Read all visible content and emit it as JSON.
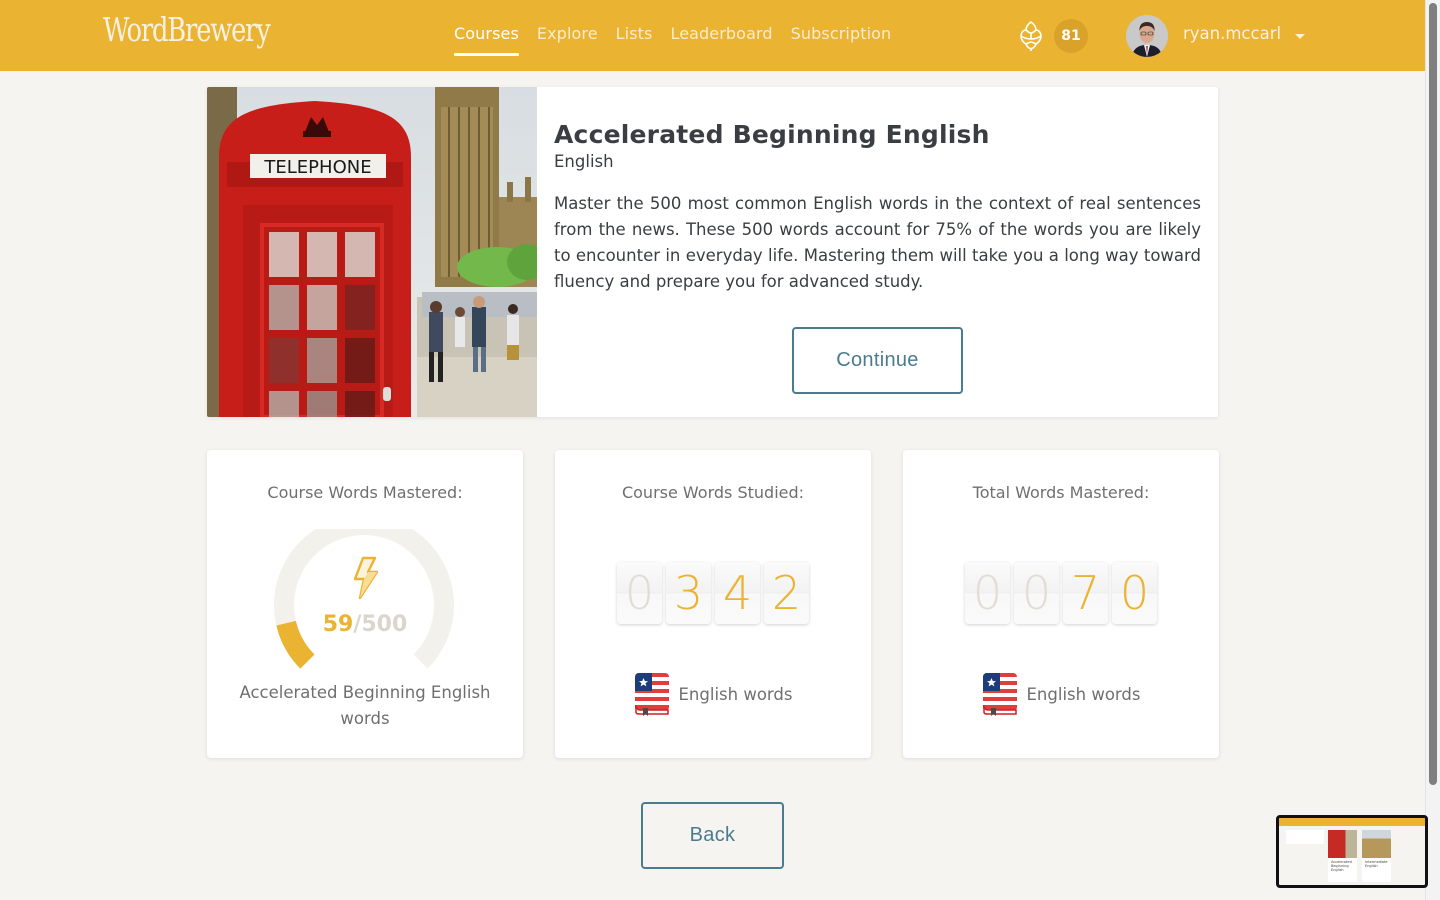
{
  "header": {
    "logo": "WordBrewery",
    "nav": [
      {
        "label": "Courses",
        "active": true
      },
      {
        "label": "Explore",
        "active": false
      },
      {
        "label": "Lists",
        "active": false
      },
      {
        "label": "Leaderboard",
        "active": false
      },
      {
        "label": "Subscription",
        "active": false
      }
    ],
    "score_icon": "hop-icon",
    "score": "81",
    "username": "ryan.mccarl"
  },
  "course": {
    "image": "london-telephone-booth-big-ben",
    "booth_sign": "TELEPHONE",
    "title": "Accelerated Beginning English",
    "language": "English",
    "description": "Master the 500 most common English words in the context of real sentences from the news. These 500 words account for 75% of the words you are likely to encounter in everyday life. Mastering them will take you a long way toward fluency and prepare you for advanced study.",
    "continue_label": "Continue"
  },
  "stats": {
    "mastered": {
      "label": "Course Words Mastered:",
      "value": "59",
      "separator": "/",
      "total": "500",
      "progress_fraction": 0.118,
      "icon": "lightning-bolt-icon",
      "caption": "Accelerated Beginning English words"
    },
    "studied": {
      "label": "Course Words Studied:",
      "digits": [
        "0",
        "3",
        "4",
        "2"
      ],
      "leading_zeros": 1,
      "icon": "us-flag-book-icon",
      "caption": "English words"
    },
    "total": {
      "label": "Total Words Mastered:",
      "digits": [
        "0",
        "0",
        "7",
        "0"
      ],
      "leading_zeros": 2,
      "icon": "us-flag-book-icon",
      "caption": "English words"
    }
  },
  "back_label": "Back",
  "colors": {
    "brand": "#ebb332",
    "button": "#4a7c8e",
    "background": "#f5f4f0"
  },
  "preview": {
    "cards": [
      "Accelerated Beginning English",
      "Intermediate English"
    ]
  }
}
